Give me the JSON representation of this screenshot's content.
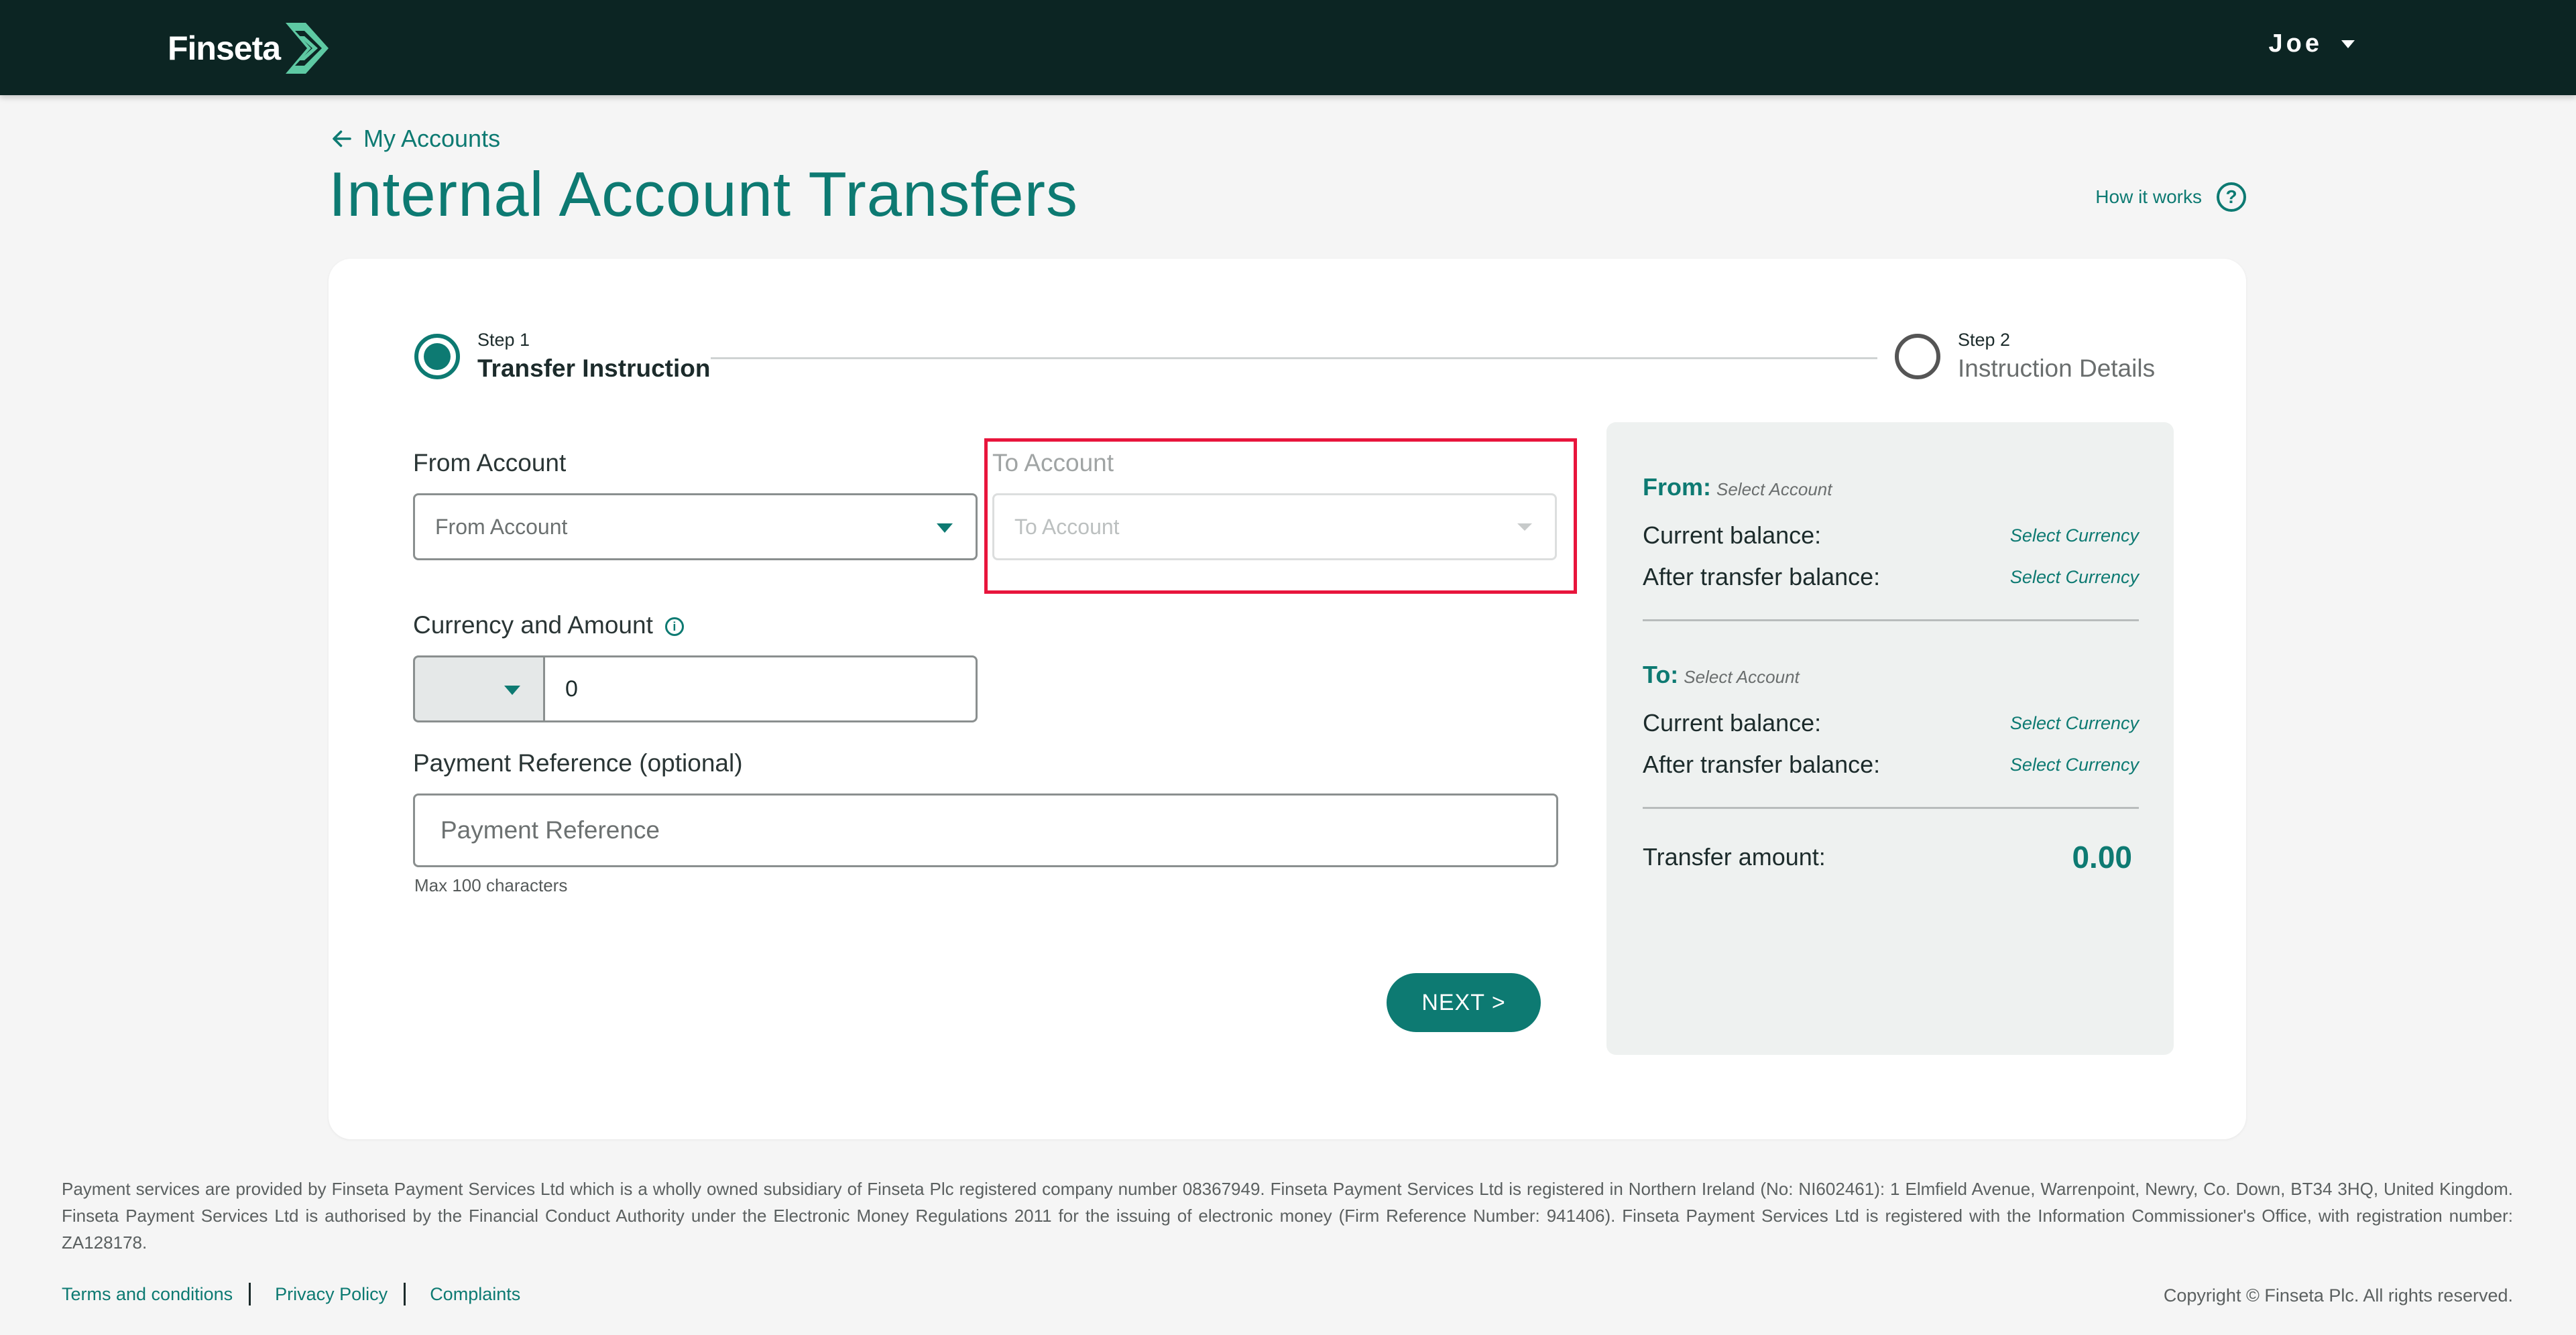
{
  "header": {
    "brand": "Finseta",
    "user": "Joe"
  },
  "nav": {
    "back_label": "My Accounts"
  },
  "page": {
    "title": "Internal Account Transfers",
    "how_it_works": "How it works"
  },
  "steps": [
    {
      "small": "Step 1",
      "label": "Transfer Instruction"
    },
    {
      "small": "Step 2",
      "label": "Instruction Details"
    }
  ],
  "form": {
    "from_label": "From Account",
    "from_placeholder": "From Account",
    "to_label": "To Account",
    "to_placeholder": "To Account",
    "currency_label": "Currency and Amount",
    "amount_value": "0",
    "reference_label": "Payment Reference (optional)",
    "reference_placeholder": "Payment Reference",
    "reference_hint": "Max 100 characters",
    "next_label": "NEXT  >"
  },
  "summary": {
    "from_heading": "From:",
    "from_select": "Select Account",
    "to_heading": "To:",
    "to_select": "Select Account",
    "current_balance_label": "Current balance:",
    "after_balance_label": "After transfer balance:",
    "select_currency": "Select Currency",
    "transfer_amount_label": "Transfer amount:",
    "transfer_amount_value": "0.00"
  },
  "footer": {
    "legal": "Payment services are provided by Finseta Payment Services Ltd which is a wholly owned subsidiary of Finseta Plc registered company number 08367949. Finseta Payment Services Ltd is registered in Northern Ireland (No: NI602461): 1 Elmfield Avenue, Warrenpoint, Newry, Co. Down, BT34 3HQ, United Kingdom. Finseta Payment Services Ltd is authorised by the Financial Conduct Authority under the Electronic Money Regulations 2011 for the issuing of electronic money (Firm Reference Number: 941406). Finseta Payment Services Ltd is registered with the Information Commissioner's Office, with registration number: ZA128178.",
    "links": [
      "Terms and conditions",
      "Privacy Policy",
      "Complaints"
    ],
    "copyright": "Copyright © Finseta Plc. All rights reserved."
  },
  "colors": {
    "brand_dark": "#0c2523",
    "accent": "#0d7a72",
    "highlight": "#e8153c"
  }
}
